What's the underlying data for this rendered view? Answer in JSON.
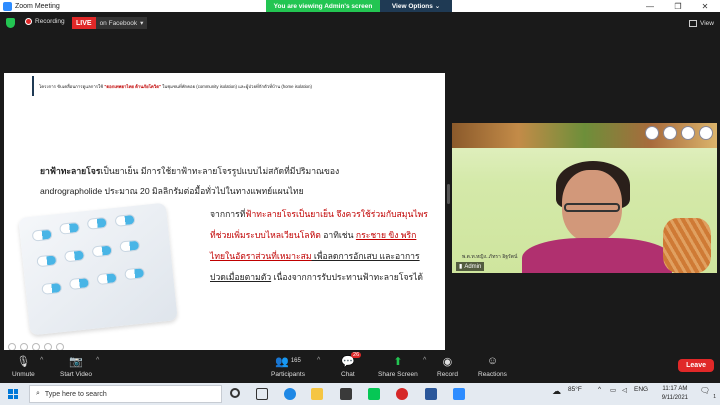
{
  "window": {
    "title": "Zoom Meeting"
  },
  "banner": {
    "viewing": "You are viewing Admin's screen",
    "options": "View Options ⌄"
  },
  "topbar": {
    "recording": "Recording",
    "live": "LIVE",
    "live_target": "on Facebook",
    "view": "View"
  },
  "slide": {
    "header_a": "โครงการ ขับเคลื่อนการดูแลการใช้",
    "header_red": "\"ดอกเทพยาไทย ต้านภัยโควิด\"",
    "header_b": "ในชุมชนที่พักคอย (community isolation) และผู้ป่วยที่กักตัวที่บ้าน (home isolation)",
    "p1_bold": "ยาฟ้าทะลายโจร",
    "p1_rest": "เป็นยาเย็น มีการใช้ยาฟ้าทะลายโจรรูปแบบไม่สกัดที่มีปริมาณของ",
    "p1_line2": "andrographolide ประมาณ 20 มิลลิกรัมต่อมื้อทั่วไปในทางแพทย์แผนไทย",
    "p2_a": "จากการที่",
    "p2_red1": "ฟ้าทะลายโจรเป็นยาเย็น จึงควรใช้ร่วมกับสมุนไพรที่ช่วยเพิ่มระบบไหลเวียนโลหิต",
    "p2_b": " อาทิเช่น ",
    "p2_red2": "กระชาย ขิง พริกไทยในอัตราส่วนที่เหมาะสม",
    "p2_c": " เพื่อลดการอักเสบ และอาการปวดเมื่อยตามตัว",
    "p2_d": " เนื่องจากการรับประทานฟ้าทะลายโจรได้"
  },
  "video": {
    "name_tag": "พ.ต.ท.หญิง..ภัทรา อิฐรัตน์",
    "participant": "Admin"
  },
  "toolbar": {
    "unmute": "Unmute",
    "start_video": "Start Video",
    "participants": "Participants",
    "participant_count": "165",
    "chat": "Chat",
    "chat_badge": "26",
    "share_screen": "Share Screen",
    "record": "Record",
    "reactions": "Reactions",
    "leave": "Leave"
  },
  "taskbar": {
    "search_placeholder": "Type here to search",
    "weather": "85°F",
    "lang": "ENG",
    "time": "11:17 AM",
    "date": "9/11/2021",
    "notif": "1"
  },
  "colors": {
    "zoom_blue": "#2d8cff",
    "live_red": "#e02828",
    "banner_green": "#23c552",
    "share_green": "#23c552"
  }
}
